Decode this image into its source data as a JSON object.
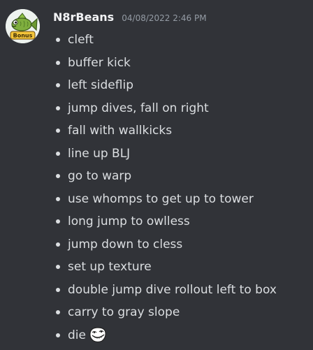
{
  "message": {
    "author": {
      "username": "N8rBeans",
      "avatar_icon": "fish-avatar-icon",
      "avatar_text": "Bonus"
    },
    "timestamp": "04/08/2022 2:46 PM",
    "items": [
      {
        "label": "cleft"
      },
      {
        "label": "buffer kick"
      },
      {
        "label": "left sideflip"
      },
      {
        "label": "jump dives, fall on right"
      },
      {
        "label": "fall with wallkicks"
      },
      {
        "label": "line up BLJ"
      },
      {
        "label": "go to warp"
      },
      {
        "label": "use whomps to get up to tower"
      },
      {
        "label": "long jump to owlless"
      },
      {
        "label": "jump down to cless"
      },
      {
        "label": "set up texture"
      },
      {
        "label": "double jump dive rollout left to box"
      },
      {
        "label": "carry to gray slope"
      },
      {
        "label": "die",
        "emoji": "trollface-emoji-icon"
      }
    ]
  },
  "colors": {
    "background": "#313338",
    "username": "#f2f3f5",
    "timestamp": "#949ba4",
    "text": "#dbdee1"
  }
}
